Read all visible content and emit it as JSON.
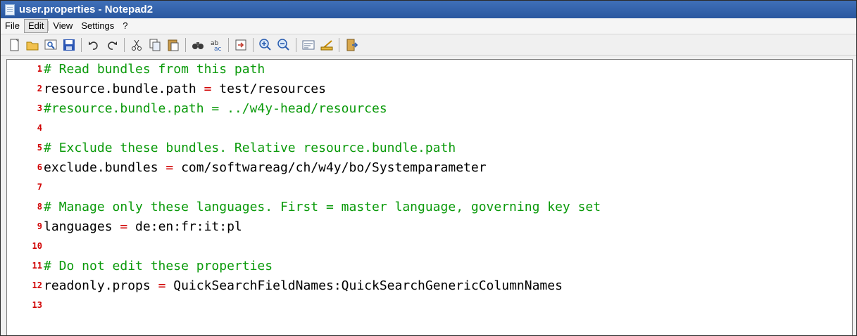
{
  "window": {
    "title": "user.properties - Notepad2"
  },
  "menu": [
    "File",
    "Edit",
    "View",
    "Settings",
    "?"
  ],
  "toolbar_icons": [
    "new-icon",
    "open-icon",
    "browse-icon",
    "save-icon",
    "sep",
    "undo-icon",
    "redo-icon",
    "sep",
    "cut-icon",
    "copy-icon",
    "paste-icon",
    "sep",
    "find-icon",
    "replace-icon",
    "sep",
    "goto-icon",
    "sep",
    "zoom-in-icon",
    "zoom-out-icon",
    "sep",
    "word-wrap-icon",
    "long-line-icon",
    "sep",
    "exit-icon"
  ],
  "editor": {
    "lines": [
      {
        "n": "1",
        "text": "# Read bundles from this path",
        "comment": true
      },
      {
        "n": "2",
        "key": "resource.bundle.path",
        "value": "test/resources"
      },
      {
        "n": "3",
        "text": "#resource.bundle.path = ../w4y-head/resources",
        "comment": true
      },
      {
        "n": "4",
        "text": ""
      },
      {
        "n": "5",
        "text": "# Exclude these bundles. Relative resource.bundle.path",
        "comment": true
      },
      {
        "n": "6",
        "key": "exclude.bundles",
        "value": "com/softwareag/ch/w4y/bo/Systemparameter"
      },
      {
        "n": "7",
        "text": ""
      },
      {
        "n": "8",
        "text": "# Manage only these languages. First = master language, governing key set",
        "comment": true
      },
      {
        "n": "9",
        "key": "languages",
        "value": "de:en:fr:it:pl"
      },
      {
        "n": "10",
        "text": ""
      },
      {
        "n": "11",
        "text": "# Do not edit these properties",
        "comment": true
      },
      {
        "n": "12",
        "key": "readonly.props",
        "value": "QuickSearchFieldNames:QuickSearchGenericColumnNames"
      },
      {
        "n": "13",
        "text": ""
      }
    ]
  },
  "colors": {
    "comment": "#0a9a0a",
    "line_number": "#d00000",
    "operator": "#d00000",
    "title_bar": "#2f60aa"
  }
}
